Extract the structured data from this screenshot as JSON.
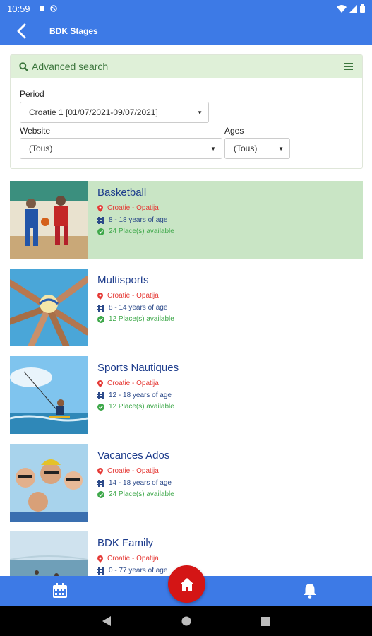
{
  "status_bar": {
    "time": "10:59"
  },
  "app_bar": {
    "title": "BDK Stages"
  },
  "search": {
    "header_label": "Advanced search",
    "period_label": "Period",
    "period_value": "Croatie 1 [01/07/2021-09/07/2021]",
    "website_label": "Website",
    "website_value": "(Tous)",
    "ages_label": "Ages",
    "ages_value": "(Tous)"
  },
  "stages": [
    {
      "title": "Basketball",
      "location": "Croatie - Opatija",
      "ages": "8 - 18 years of age",
      "availability": "24 Place(s) available"
    },
    {
      "title": "Multisports",
      "location": "Croatie - Opatija",
      "ages": "8 - 14 years of age",
      "availability": "12 Place(s) available"
    },
    {
      "title": "Sports Nautiques",
      "location": "Croatie - Opatija",
      "ages": "12 - 18 years of age",
      "availability": "12 Place(s) available"
    },
    {
      "title": "Vacances Ados",
      "location": "Croatie - Opatija",
      "ages": "14 - 18 years of age",
      "availability": "24 Place(s) available"
    },
    {
      "title": "BDK Family",
      "location": "Croatie - Opatija",
      "ages": "0 - 77 years of age",
      "availability": ""
    }
  ],
  "colors": {
    "primary": "#3d7ae6",
    "active_row": "#c9e5c5",
    "fab": "#d41515",
    "location": "#e53935",
    "available": "#3ea84a"
  },
  "icons": {
    "bottom_nav": [
      "calendar-icon",
      "home-icon",
      "bell-icon"
    ],
    "system_nav": [
      "back-triangle-icon",
      "home-circle-icon",
      "recents-square-icon"
    ]
  }
}
